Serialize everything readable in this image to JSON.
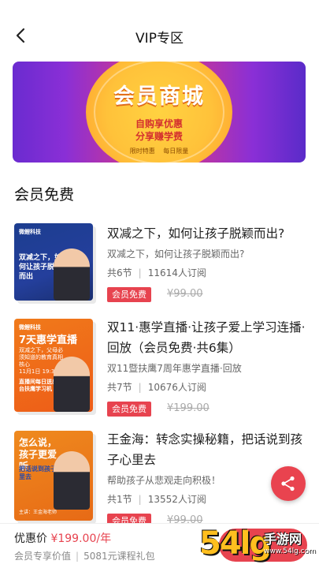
{
  "nav": {
    "title": "VIP专区"
  },
  "banner": {
    "main": "会员商城",
    "line1": "自购享优惠",
    "line2": "分享赚学费",
    "tags": [
      "限时特惠",
      "每日限量"
    ]
  },
  "section": {
    "title": "会员免费"
  },
  "courses": [
    {
      "title": "双减之下，如何让孩子脱颖而出?",
      "subtitle": "双减之下，如何让孩子脱颖而出?",
      "sections": "共6节",
      "subs": "11614人订阅",
      "badge": "会员免费",
      "price": "¥99.00",
      "cover": {
        "brand": "微鲤科技",
        "headline": "双减之下，如何让孩子脱颖而出"
      }
    },
    {
      "title": "双11·惠学直播·让孩子爱上学习连播·回放（会员免费·共6集）",
      "subtitle": "双11暨扶鹰7周年惠学直播·回放",
      "sections": "共7节",
      "subs": "10676人订阅",
      "badge": "会员免费",
      "price": "¥199.00",
      "cover": {
        "brand": "微鲤科技",
        "headline": "7天惠学直播",
        "tagline": "双减之下，父母必须知道的教育真相核心",
        "date": "11月1日 19:30",
        "note": "直播间每日送出5台扶鹰学习机"
      }
    },
    {
      "title": "王金海：转念实操秘籍，把话说到孩子心里去",
      "subtitle": "帮助孩子从悲观走向积极！",
      "sections": "共1节",
      "subs": "13552人订阅",
      "badge": "会员免费",
      "price": "¥99.00",
      "cover": {
        "headline": "怎么说，孩子更爱听",
        "tagline": "把话说到孩子心里去",
        "speaker": "主讲：王金海老师"
      }
    }
  ],
  "bottom": {
    "price_label": "优惠价",
    "price": "¥199.00/年",
    "desc_left": "会员专享价值",
    "desc_right": "5081元课程礼包"
  },
  "watermark": {
    "num": "54lg",
    "text": "手游网",
    "url": "www.54lg.com"
  },
  "colors": {
    "accent": "#e7434f",
    "banner_purple": "#7b2fd3",
    "banner_gold": "#ffc23a"
  }
}
